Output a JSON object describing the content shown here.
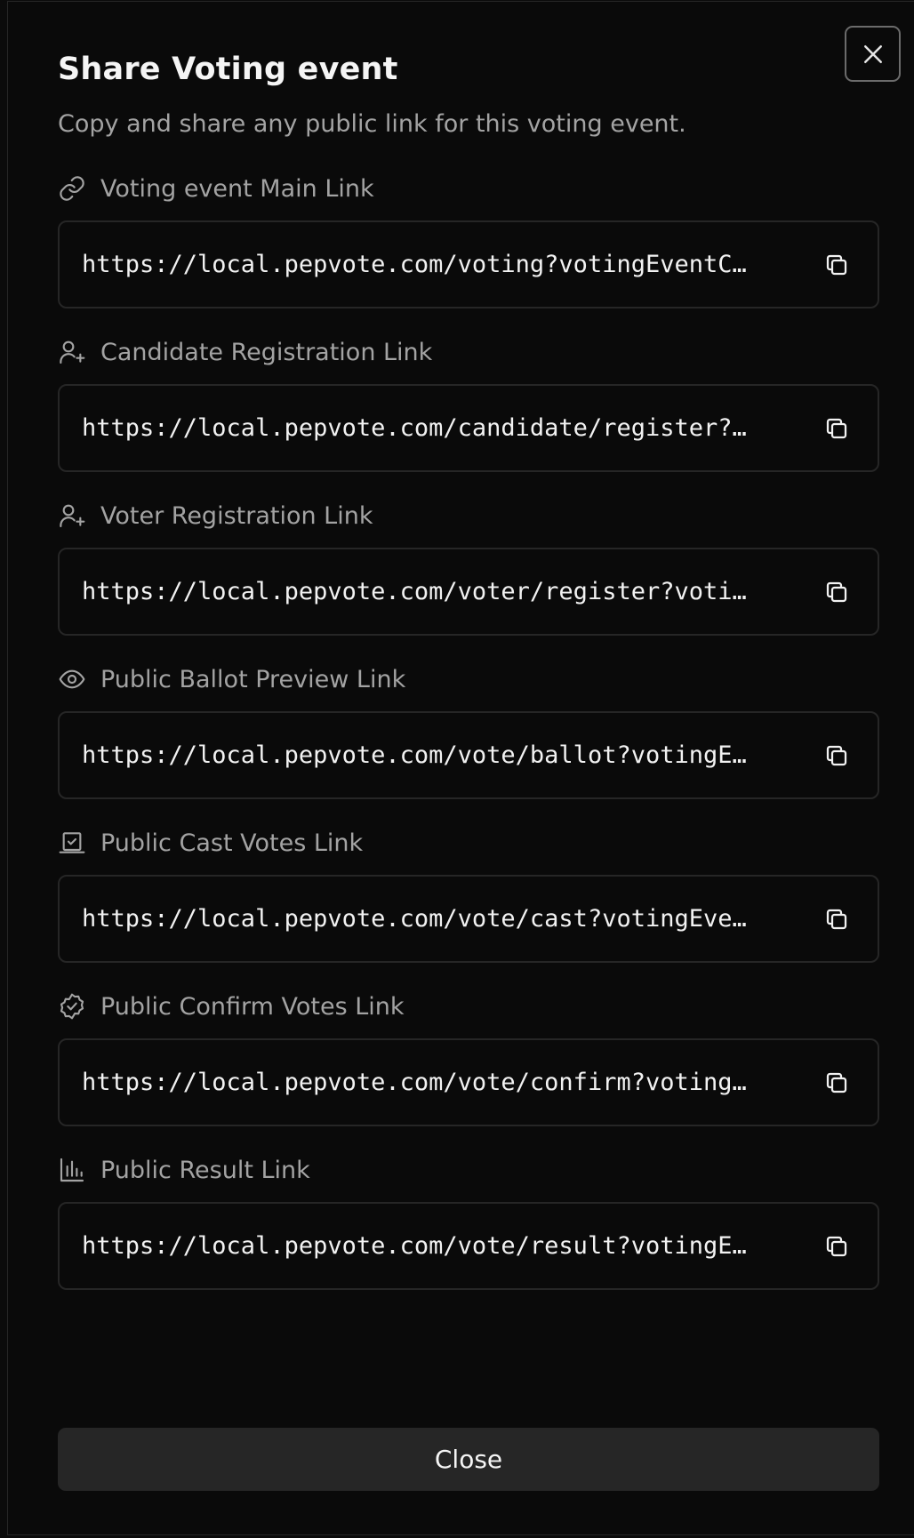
{
  "dialog": {
    "title": "Share Voting event",
    "description": "Copy and share any public link for this voting event.",
    "close_button_label": "Close"
  },
  "links": [
    {
      "icon": "link-icon",
      "label": "Voting event Main Link",
      "url": "https://local.pepvote.com/voting?votingEventC…"
    },
    {
      "icon": "user-plus-icon",
      "label": "Candidate Registration Link",
      "url": "https://local.pepvote.com/candidate/register?…"
    },
    {
      "icon": "user-plus-icon",
      "label": "Voter Registration Link",
      "url": "https://local.pepvote.com/voter/register?voti…"
    },
    {
      "icon": "eye-icon",
      "label": "Public Ballot Preview Link",
      "url": "https://local.pepvote.com/vote/ballot?votingE…"
    },
    {
      "icon": "ballot-box-icon",
      "label": "Public Cast Votes Link",
      "url": "https://local.pepvote.com/vote/cast?votingEve…"
    },
    {
      "icon": "badge-check-icon",
      "label": "Public Confirm Votes Link",
      "url": "https://local.pepvote.com/vote/confirm?voting…"
    },
    {
      "icon": "bar-chart-icon",
      "label": "Public Result Link",
      "url": "https://local.pepvote.com/vote/result?votingE…"
    }
  ],
  "colors": {
    "background": "#0a0a0a",
    "border": "#262626",
    "text_primary": "#f5f5f5",
    "text_muted": "#a3a3a3",
    "button_bg": "#262626"
  }
}
